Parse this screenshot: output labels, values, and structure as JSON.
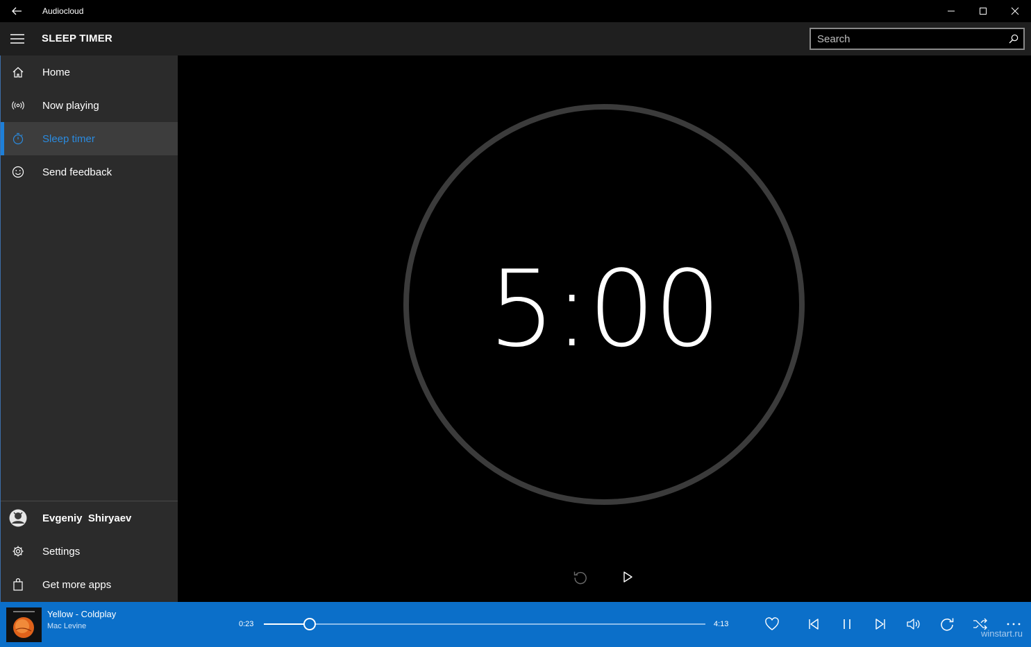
{
  "window": {
    "title": "Audiocloud"
  },
  "header": {
    "page_title": "SLEEP TIMER",
    "search_placeholder": "Search"
  },
  "sidebar": {
    "items": [
      {
        "label": "Home",
        "icon": "home-icon"
      },
      {
        "label": "Now playing",
        "icon": "broadcast-icon"
      },
      {
        "label": "Sleep timer",
        "icon": "stopwatch-icon",
        "selected": true
      },
      {
        "label": "Send feedback",
        "icon": "smiley-icon"
      }
    ],
    "bottom": [
      {
        "label": "Evgeniy  Shiryaev",
        "icon": "avatar"
      },
      {
        "label": "Settings",
        "icon": "gear-icon"
      },
      {
        "label": "Get more apps",
        "icon": "store-icon"
      }
    ]
  },
  "timer": {
    "display": "5:00"
  },
  "player": {
    "song": "Yellow - Coldplay",
    "artist": "Mac Levine",
    "current_time": "0:23",
    "total_time": "4:13",
    "progress": 0.103
  },
  "watermark": "winstart.ru",
  "colors": {
    "accent": "#0b6fc9",
    "selected_text": "#2a8be0"
  }
}
